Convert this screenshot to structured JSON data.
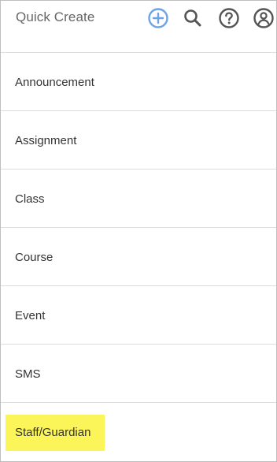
{
  "header": {
    "title": "Quick Create",
    "icons": {
      "add": "plus-circle-icon",
      "search": "search-icon",
      "help": "help-circle-icon",
      "account": "account-icon"
    },
    "accent_color": "#6fa3e8"
  },
  "menu": {
    "items": [
      {
        "label": "Announcement"
      },
      {
        "label": "Assignment"
      },
      {
        "label": "Class"
      },
      {
        "label": "Course"
      },
      {
        "label": "Event"
      },
      {
        "label": "SMS"
      },
      {
        "label": "Staff/Guardian",
        "highlighted": true
      }
    ],
    "highlight_color": "#fbf55a"
  }
}
